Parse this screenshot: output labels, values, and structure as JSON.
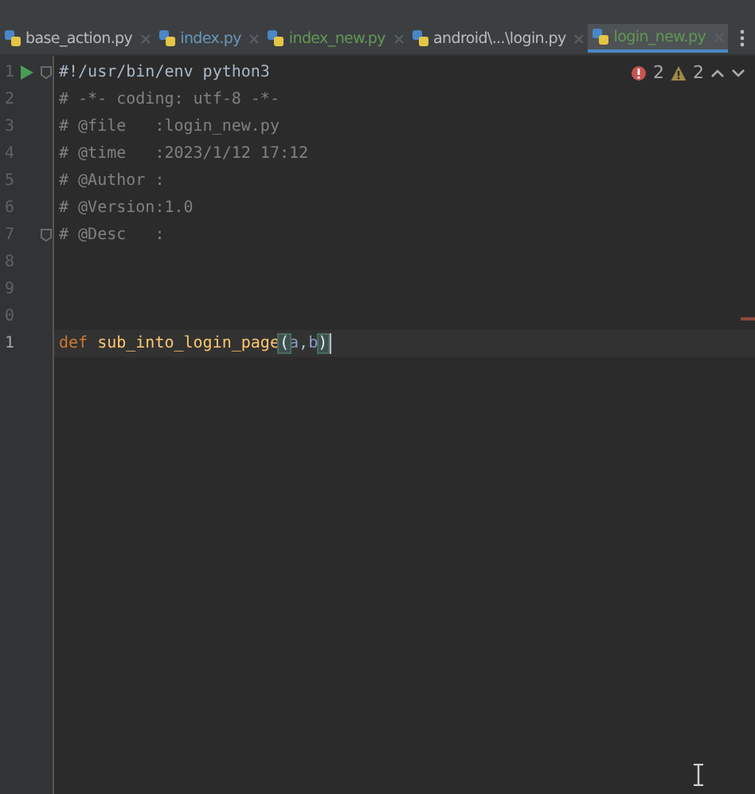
{
  "tabs": [
    {
      "label": "base_action.py",
      "color": "#bbbbbb",
      "selected": false
    },
    {
      "label": "index.py",
      "color": "#6897bb",
      "selected": false
    },
    {
      "label": "index_new.py",
      "color": "#629755",
      "selected": false
    },
    {
      "label": "android\\...\\login.py",
      "color": "#bbbbbb",
      "selected": false
    },
    {
      "label": "login_new.py",
      "color": "#629755",
      "selected": true
    }
  ],
  "inspections": {
    "errors": "2",
    "warnings": "2"
  },
  "lines": [
    {
      "number": "1",
      "gutter_icons": [
        {
          "kind": "run"
        },
        {
          "kind": "fold"
        }
      ],
      "current": false,
      "tokens": [
        {
          "kind": "shebang",
          "text": "#!/usr/bin/env python3"
        }
      ]
    },
    {
      "number": "2",
      "current": false,
      "tokens": [
        {
          "kind": "comment",
          "text": "# -*- coding: utf-8 -*-"
        }
      ]
    },
    {
      "number": "3",
      "current": false,
      "tokens": [
        {
          "kind": "comment",
          "text": "# @file   :login_new.py"
        }
      ]
    },
    {
      "number": "4",
      "current": false,
      "tokens": [
        {
          "kind": "comment",
          "text": "# @time   :2023/1/12 17:12"
        }
      ]
    },
    {
      "number": "5",
      "current": false,
      "tokens": [
        {
          "kind": "comment",
          "text": "# @Author :"
        }
      ]
    },
    {
      "number": "6",
      "current": false,
      "tokens": [
        {
          "kind": "comment",
          "text": "# @Version:1.0"
        }
      ]
    },
    {
      "number": "7",
      "gutter_icons": [
        {
          "kind": "fold"
        }
      ],
      "current": false,
      "tokens": [
        {
          "kind": "comment",
          "text": "# @Desc   :"
        }
      ]
    },
    {
      "number": "8",
      "current": false
    },
    {
      "number": "9",
      "current": false
    },
    {
      "number": "0",
      "current": false
    },
    {
      "number": "1",
      "current": true,
      "tokens": [
        {
          "kind": "keyword",
          "text": "def"
        },
        {
          "kind": "function",
          "text": "sub_into_login_page"
        },
        {
          "kind": "brace",
          "text": "("
        },
        {
          "kind": "param",
          "text": "a"
        },
        {
          "kind": "plain",
          "text": ","
        },
        {
          "kind": "param",
          "text": "b"
        },
        {
          "kind": "brace",
          "text": ")"
        }
      ]
    }
  ]
}
